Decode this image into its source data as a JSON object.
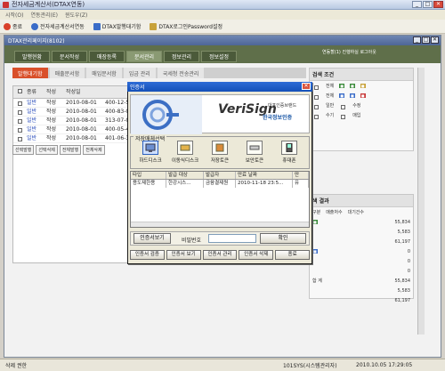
{
  "app": {
    "title": "전자세금계산서(DTAX연동)"
  },
  "menu": [
    "시작(O)",
    "연동관리(E)",
    "윈도우(Z)"
  ],
  "toolbar": {
    "items": [
      {
        "label": "종료",
        "color": "#d9412b"
      },
      {
        "label": "전자세금계산서연동",
        "color": "#3a6cc8"
      },
      {
        "label": "DTAX발행대기함",
        "color": "#3a6cc8"
      },
      {
        "label": "DTAX로그인Password설정",
        "color": "#c8a23a"
      }
    ]
  },
  "inner_window": {
    "title": "DTAX관리페이지(8102)"
  },
  "nav": {
    "tabs": [
      "발행현황",
      "문서작성",
      "매장등록",
      "문서관리",
      "정보관리",
      "정보설정"
    ],
    "active_index": 3
  },
  "user": {
    "text": "연동할(1)  진행하실 로그아웃",
    "logout": "로그아웃"
  },
  "subtabs": {
    "items": [
      "발행대기함",
      "매출문서함",
      "매입문서함",
      "입금 관리",
      "국세청 전송관리"
    ],
    "active_index": 0
  },
  "list": {
    "headers": [
      "",
      "종류",
      "작성",
      "작성일",
      "",
      ""
    ],
    "rows": [
      {
        "kind": "일반",
        "type": "작성",
        "date": "2010-08-01",
        "num": "400-12-5674"
      },
      {
        "kind": "일반",
        "type": "작성",
        "date": "2010-08-01",
        "num": "400-83-0023"
      },
      {
        "kind": "일반",
        "type": "작성",
        "date": "2010-08-01",
        "num": "313-07-00373"
      },
      {
        "kind": "일반",
        "type": "작성",
        "date": "2010-08-01",
        "num": "400-05-4158"
      },
      {
        "kind": "일반",
        "type": "작성",
        "date": "2010-08-01",
        "num": "401-06-34418"
      }
    ],
    "buttons": [
      "선택발행",
      "선택삭제",
      "전체발행",
      "전체삭제"
    ]
  },
  "search_panel": {
    "title": "검색 조건",
    "options": [
      "전체",
      "전체",
      "일반",
      "수기",
      "수정",
      "매입"
    ]
  },
  "result_panel": {
    "title": "색 결과",
    "headers": [
      "구분",
      "매출처수",
      "대기건수",
      "공급가액/세액/합계금액"
    ],
    "values": [
      "55,834",
      "5,583",
      "61,197",
      "0",
      "0",
      "0",
      "55,834",
      "5,583",
      "61,197"
    ],
    "total_label": "합 계"
  },
  "dialog": {
    "title": "인증서",
    "brand": "VeriSign",
    "brand_sub": "대표인증브랜드",
    "brand_sub2": "한국정보인증",
    "media_label": "저장매체선택",
    "media": [
      "하드디스크",
      "이동식디스크",
      "저장토큰",
      "보안토큰",
      "휴대폰"
    ],
    "table_headers": [
      "타입",
      "발급 대상",
      "발급자",
      "만료 날짜",
      "만"
    ],
    "table_rows": [
      {
        "type": "용도제한용",
        "subject": "한강시스...",
        "issuer": "금융결제원",
        "expires": "2010-11-18 23:5...",
        "extra": "유"
      }
    ],
    "view_button": "인증서보기",
    "password_label": "비밀번호",
    "ok_button": "확인",
    "actions": [
      "인증서 검증",
      "인증서 보기",
      "인증서 관리",
      "인증서 삭제",
      "종료"
    ]
  },
  "status": {
    "left": "삭제 권한",
    "company": "101SYS(시스템관리자)",
    "datetime": "2010.10.05 17:29:05"
  }
}
